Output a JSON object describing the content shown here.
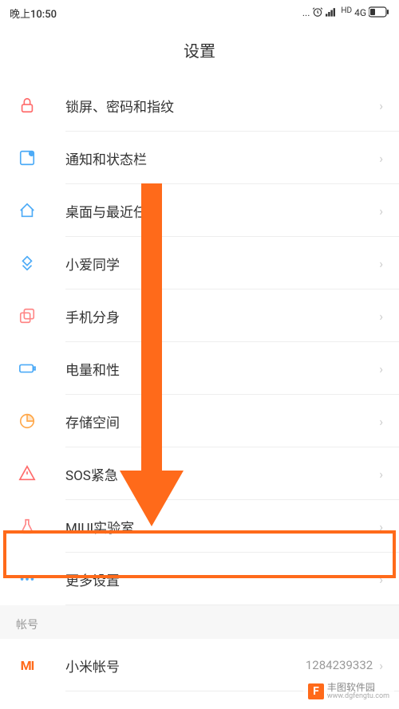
{
  "status_bar": {
    "time": "晚上10:50",
    "network": "4G"
  },
  "page_title": "设置",
  "settings": {
    "items": [
      {
        "id": "lock",
        "label": "锁屏、密码和指纹",
        "icon_color": "#ff6b6b"
      },
      {
        "id": "notification",
        "label": "通知和状态栏",
        "icon_color": "#4dabf7"
      },
      {
        "id": "desktop",
        "label": "桌面与最近任务",
        "icon_color": "#4dabf7"
      },
      {
        "id": "xiaoai",
        "label": "小爱同学",
        "icon_color": "#4dabf7"
      },
      {
        "id": "clone",
        "label": "手机分身",
        "icon_color": "#ff8787"
      },
      {
        "id": "battery",
        "label": "电量和性",
        "icon_color": "#4dabf7"
      },
      {
        "id": "storage",
        "label": "存储空间",
        "icon_color": "#ffa94d"
      },
      {
        "id": "sos",
        "label": "SOS紧急",
        "icon_color": "#ff6b6b"
      },
      {
        "id": "miui-lab",
        "label": "MIUI实验室",
        "icon_color": "#ff8787"
      },
      {
        "id": "more",
        "label": "更多设置",
        "icon_color": "#4dabf7"
      }
    ]
  },
  "account_section": {
    "header": "帐号",
    "mi_account": {
      "label": "小米帐号",
      "value": "1284239332"
    }
  },
  "watermark": {
    "name": "丰图软件园",
    "url": "www.dgfengtu.com"
  }
}
